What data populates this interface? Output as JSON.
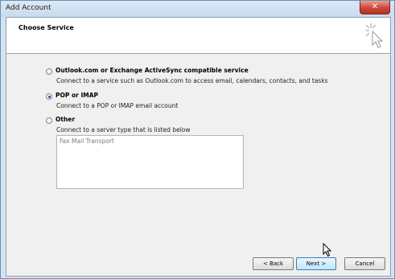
{
  "window": {
    "title": "Add Account",
    "close_symbol": "✕"
  },
  "header": {
    "title": "Choose Service",
    "icon": "sparkle-cursor-icon"
  },
  "options": [
    {
      "label": "Outlook.com or Exchange ActiveSync compatible service",
      "description": "Connect to a service such as Outlook.com to access email, calendars, contacts, and tasks",
      "selected": false
    },
    {
      "label": "POP or IMAP",
      "description": "Connect to a POP or IMAP email account",
      "selected": true
    },
    {
      "label": "Other",
      "description": "Connect to a server type that is listed below",
      "selected": false
    }
  ],
  "server_types": [
    "Fax Mail Transport"
  ],
  "buttons": {
    "back": "< Back",
    "next": "Next >",
    "cancel": "Cancel"
  }
}
